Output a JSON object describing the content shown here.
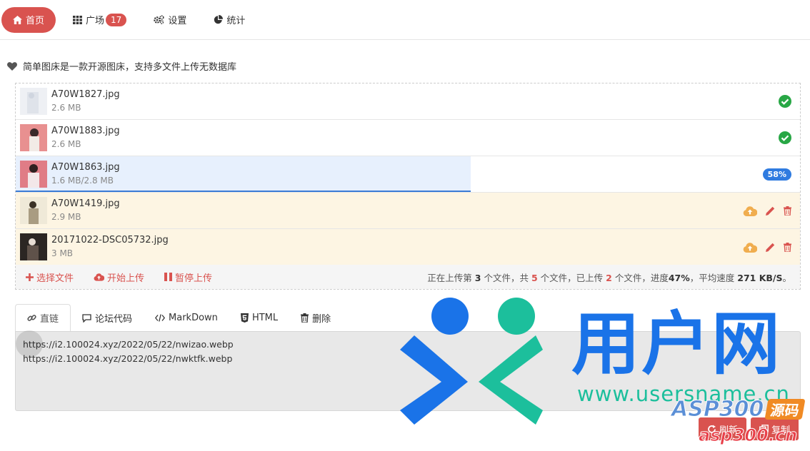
{
  "nav": {
    "home": "首页",
    "square": "广场",
    "square_badge": "17",
    "settings": "设置",
    "stats": "统计"
  },
  "notice": "简单图床是一款开源图床，支持多文件上传无数据库",
  "files": [
    {
      "name": "A70W1827.jpg",
      "size": "2.6 MB",
      "status": "done"
    },
    {
      "name": "A70W1883.jpg",
      "size": "2.6 MB",
      "status": "done"
    },
    {
      "name": "A70W1863.jpg",
      "size": "1.6 MB/2.8 MB",
      "status": "uploading",
      "progress_percent": 58,
      "progress_label": "58%"
    },
    {
      "name": "A70W1419.jpg",
      "size": "2.9 MB",
      "status": "pending"
    },
    {
      "name": "20171022-DSC05732.jpg",
      "size": "3 MB",
      "status": "pending"
    }
  ],
  "actions": {
    "select": "选择文件",
    "start": "开始上传",
    "pause": "暂停上传"
  },
  "status": {
    "p1": "正在上传第",
    "current": "3",
    "p2": "个文件，共",
    "total": "5",
    "p3": "个文件，已上传",
    "uploaded": "2",
    "p4": "个文件，进度",
    "progress": "47%",
    "p5": "，平均速度",
    "speed": "271 KB/S",
    "p6": "。"
  },
  "tabs": [
    "直链",
    "论坛代码",
    "MarkDown",
    "HTML",
    "删除"
  ],
  "results": [
    "https://i2.100024.xyz/2022/05/22/nwizao.webp",
    "https://i2.100024.xyz/2022/05/22/nwktfk.webp"
  ],
  "buttons": {
    "refresh": "刷新",
    "copy": "复制"
  },
  "watermark": {
    "brand": "用户网",
    "url": "www.usersname.cn",
    "asp": "ASP300",
    "asp_tag": "源码",
    "asp_url": "asp300.cn",
    "blue": "#1a73e8",
    "teal": "#1cbf9c"
  },
  "colors": {
    "accent": "#d9534f",
    "progress": "#2f7be0",
    "success": "#28a745",
    "warning": "#f0ad4e"
  }
}
